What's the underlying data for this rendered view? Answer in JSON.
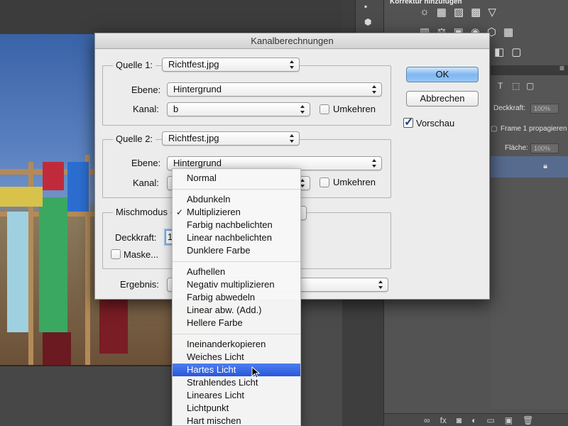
{
  "dialog": {
    "title": "Kanalberechnungen",
    "source1": {
      "label": "Quelle 1:",
      "value": "Richtfest.jpg",
      "layer_label": "Ebene:",
      "layer_value": "Hintergrund",
      "channel_label": "Kanal:",
      "channel_value": "b",
      "invert_label": "Umkehren"
    },
    "source2": {
      "label": "Quelle 2:",
      "value": "Richtfest.jpg",
      "layer_label": "Ebene:",
      "layer_value": "Hintergrund",
      "channel_label": "Kanal:",
      "invert_label": "Umkehren"
    },
    "blending": {
      "label": "Mischmodus",
      "opacity_label": "Deckkraft:",
      "opacity_value": "1",
      "mask_label": "Maske..."
    },
    "result_label": "Ergebnis:",
    "ok_label": "OK",
    "cancel_label": "Abbrechen",
    "preview_label": "Vorschau",
    "preview_checked": "✓"
  },
  "blend_menu": {
    "checkmark": "✓",
    "groups": [
      [
        "Normal"
      ],
      [
        "Abdunkeln",
        "Multiplizieren",
        "Farbig nachbelichten",
        "Linear nachbelichten",
        "Dunklere Farbe"
      ],
      [
        "Aufhellen",
        "Negativ multiplizieren",
        "Farbig abwedeln",
        "Linear abw. (Add.)",
        "Hellere Farbe"
      ],
      [
        "Ineinanderkopieren",
        "Weiches Licht",
        "Hartes Licht",
        "Strahlendes Licht",
        "Lineares Licht",
        "Lichtpunkt",
        "Hart mischen"
      ]
    ],
    "checked_item": "Multiplizieren",
    "highlighted_item": "Hartes Licht"
  },
  "panel": {
    "adjustments_title": "Korrektur hinzufügen",
    "opacity_label": "Deckkraft:",
    "opacity_value": "100%",
    "propagate_label": "Frame 1 propagieren",
    "fill_label": "Fläche:",
    "fill_value": "100%"
  },
  "colors": {
    "menu_highlight": "#2c5fe0",
    "ok_button": "#7fb7f0",
    "dialog_bg": "#ececec"
  }
}
